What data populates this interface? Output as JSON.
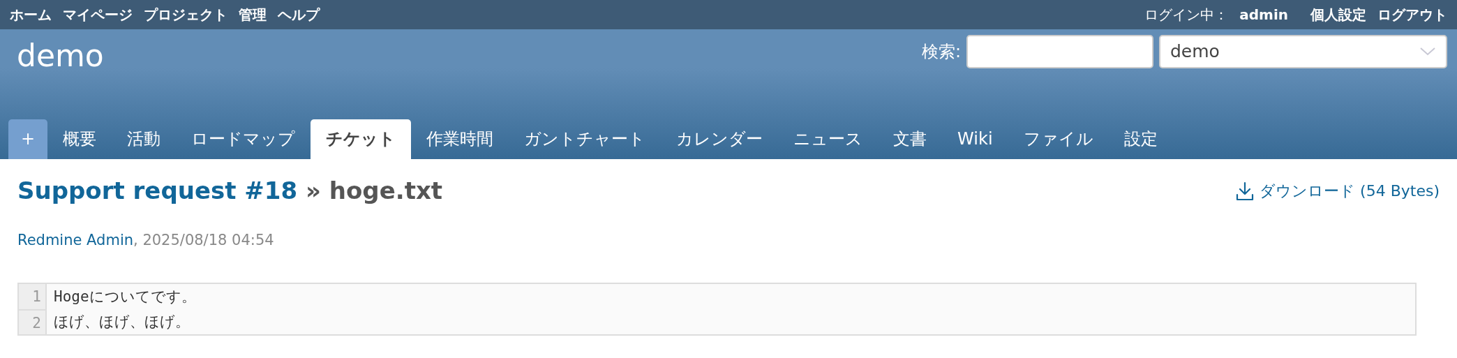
{
  "top_menu": [
    {
      "label": "ホーム"
    },
    {
      "label": "マイページ"
    },
    {
      "label": "プロジェクト"
    },
    {
      "label": "管理"
    },
    {
      "label": "ヘルプ"
    }
  ],
  "account": {
    "logged_in_label": "ログイン中：",
    "user": "admin",
    "links": [
      "個人設定",
      "ログアウト"
    ]
  },
  "header": {
    "project_title": "demo",
    "search_label": "検索:",
    "project_select": "demo"
  },
  "tabs": [
    {
      "label": "+",
      "kind": "new",
      "selected": false
    },
    {
      "label": "概要",
      "kind": "tab",
      "selected": false
    },
    {
      "label": "活動",
      "kind": "tab",
      "selected": false
    },
    {
      "label": "ロードマップ",
      "kind": "tab",
      "selected": false
    },
    {
      "label": "チケット",
      "kind": "tab",
      "selected": true
    },
    {
      "label": "作業時間",
      "kind": "tab",
      "selected": false
    },
    {
      "label": "ガントチャート",
      "kind": "tab",
      "selected": false
    },
    {
      "label": "カレンダー",
      "kind": "tab",
      "selected": false
    },
    {
      "label": "ニュース",
      "kind": "tab",
      "selected": false
    },
    {
      "label": "文書",
      "kind": "tab",
      "selected": false
    },
    {
      "label": "Wiki",
      "kind": "tab",
      "selected": false
    },
    {
      "label": "ファイル",
      "kind": "tab",
      "selected": false
    },
    {
      "label": "設定",
      "kind": "tab",
      "selected": false
    }
  ],
  "content": {
    "issue_link": "Support request #18",
    "title_rest": "» hoge.txt",
    "download": "ダウンロード (54 Bytes)",
    "author": "Redmine Admin",
    "date": ", 2025/08/18 04:54",
    "lines": [
      {
        "number": "1",
        "text": "Hogeについてです。"
      },
      {
        "number": "2",
        "text": "ほげ、ほげ、ほげ。"
      }
    ]
  }
}
